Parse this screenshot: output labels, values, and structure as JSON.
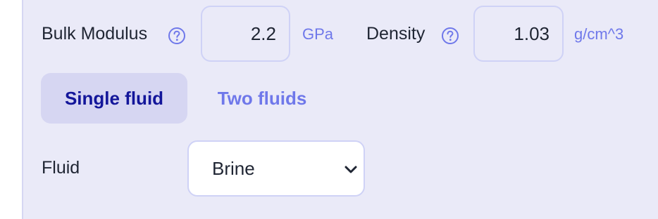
{
  "fields": {
    "bulk_modulus": {
      "label": "Bulk Modulus",
      "value": "2.2",
      "unit": "GPa"
    },
    "density": {
      "label": "Density",
      "value": "1.03",
      "unit": "g/cm^3"
    }
  },
  "tabs": [
    {
      "label": "Single fluid",
      "active": true
    },
    {
      "label": "Two fluids",
      "active": false
    }
  ],
  "fluid": {
    "label": "Fluid",
    "selected": "Brine"
  },
  "icons": {
    "help": "help-circle-icon",
    "dropdown": "chevron-down-icon"
  },
  "colors": {
    "accent": "#6f78ea",
    "active_tab_text": "#13169a",
    "panel_bg": "#eaeaf8"
  }
}
